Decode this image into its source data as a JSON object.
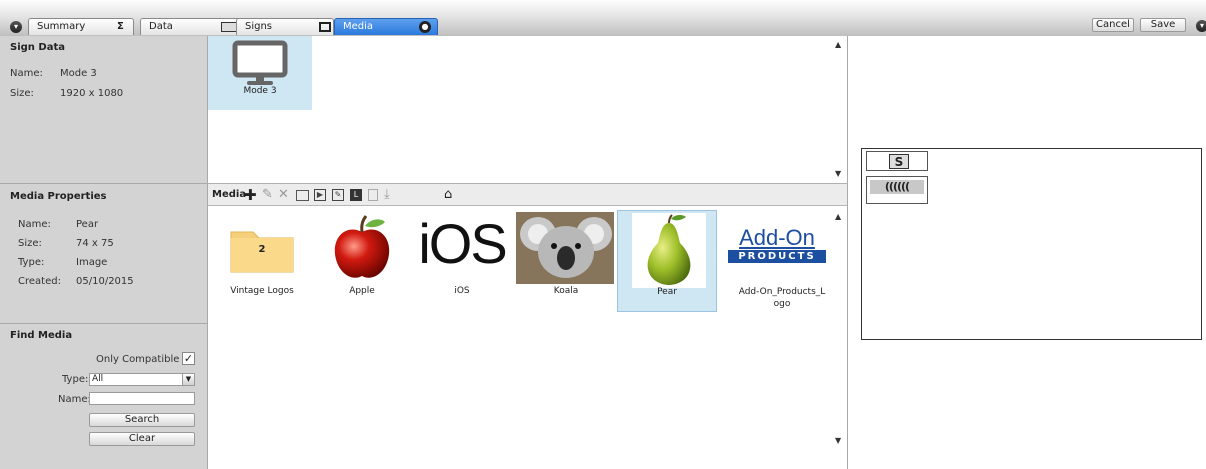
{
  "tabs": [
    {
      "label": "Summary",
      "icon": "sigma-icon",
      "glyph": "Σ"
    },
    {
      "label": "Data",
      "icon": "keyboard-icon"
    },
    {
      "label": "Signs",
      "icon": "monitor-icon"
    },
    {
      "label": "Media",
      "icon": "globe-icon",
      "active": true
    }
  ],
  "actions": {
    "cancel": "Cancel",
    "save": "Save"
  },
  "sign_data": {
    "title": "Sign Data",
    "name_label": "Name:",
    "name": "Mode 3",
    "size_label": "Size:",
    "size": "1920 x 1080"
  },
  "media_properties": {
    "title": "Media Properties",
    "name_label": "Name:",
    "name": "Pear",
    "size_label": "Size:",
    "size": "74 x 75",
    "type_label": "Type:",
    "type": "Image",
    "created_label": "Created:",
    "created": "05/10/2015"
  },
  "find_media": {
    "title": "Find Media",
    "only_compatible": "Only Compatible",
    "only_compatible_checked": true,
    "type_label": "Type:",
    "type_value": "All",
    "name_label": "Name:",
    "name_value": "",
    "search": "Search",
    "clear": "Clear"
  },
  "signs": [
    {
      "label": "Mode 3"
    }
  ],
  "media_toolbar": {
    "label": "Media"
  },
  "media": [
    {
      "label": "Vintage Logos",
      "kind": "folder",
      "count": "2"
    },
    {
      "label": "Apple",
      "kind": "image"
    },
    {
      "label": "iOS",
      "kind": "image",
      "text": "iOS"
    },
    {
      "label": "Koala",
      "kind": "image"
    },
    {
      "label": "Pear",
      "kind": "image",
      "selected": true
    },
    {
      "label": "Add-On_Products_Logo",
      "kind": "image",
      "logo_top": "Add-On",
      "logo_bottom": "PRODUCTS"
    }
  ],
  "colors": {
    "accent": "#2b79dc",
    "selection": "#cfe6f3",
    "panel": "#d3d3d3"
  }
}
